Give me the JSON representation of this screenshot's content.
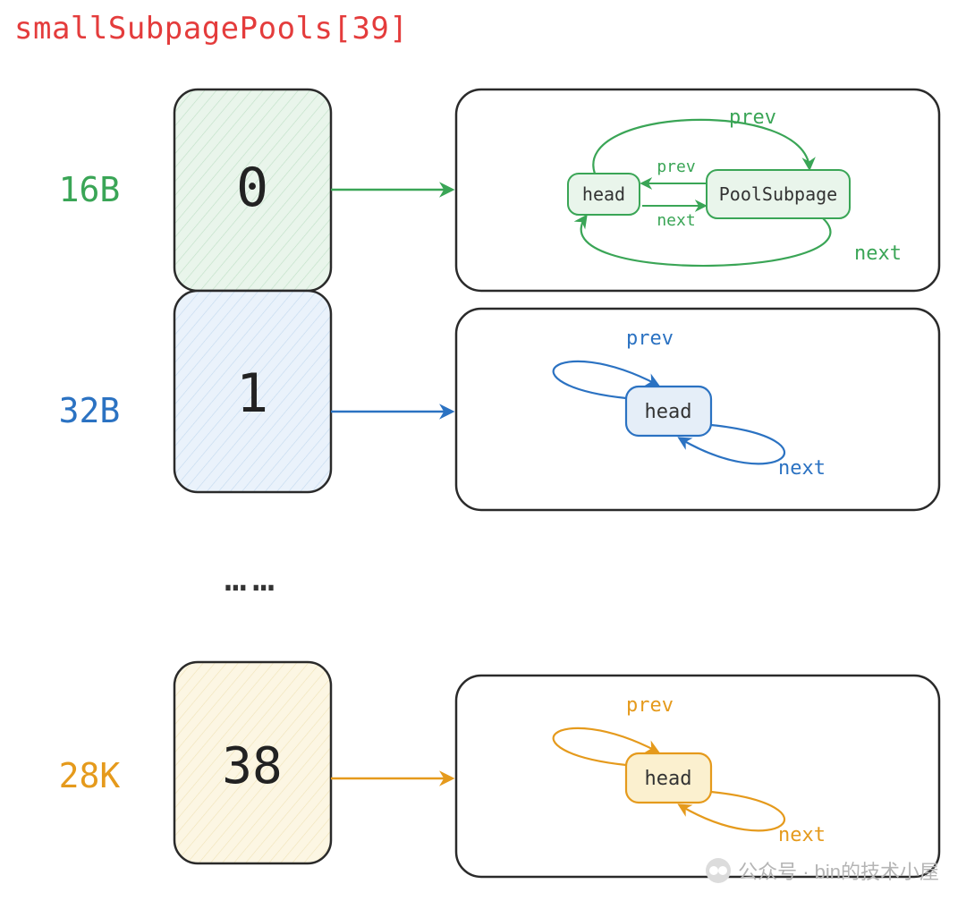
{
  "title": "smallSubpagePools[39]",
  "rows": [
    {
      "size_label": "16B",
      "index": "0",
      "color": "#3aa556",
      "fill": "#e6f3e8",
      "linked_list": {
        "nodes": [
          "head",
          "PoolSubpage"
        ],
        "prev_label": "prev",
        "next_label": "next"
      }
    },
    {
      "size_label": "32B",
      "index": "1",
      "color": "#2b72c2",
      "fill": "#e5eef8",
      "linked_list": {
        "nodes": [
          "head"
        ],
        "prev_label": "prev",
        "next_label": "next"
      }
    },
    {
      "size_label": "28K",
      "index": "38",
      "color": "#e59a1c",
      "fill": "#fbf4dd",
      "linked_list": {
        "nodes": [
          "head"
        ],
        "prev_label": "prev",
        "next_label": "next"
      }
    }
  ],
  "ellipsis": "……",
  "watermark": "公众号 · bin的技术小屋"
}
